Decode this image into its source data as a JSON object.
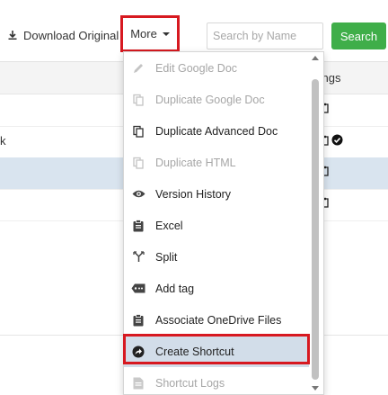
{
  "toolbar": {
    "download_label": "Download Original",
    "more_label": "More",
    "search_placeholder": "Search by Name",
    "search_button_label": "Search"
  },
  "table": {
    "column_header": "tings",
    "row_partial_text": "k"
  },
  "menu": {
    "items": [
      {
        "label": "Edit Google Doc",
        "icon": "pencil-icon",
        "disabled": true
      },
      {
        "label": "Duplicate Google Doc",
        "icon": "copy-icon",
        "disabled": true
      },
      {
        "label": "Duplicate Advanced Doc",
        "icon": "copy-icon",
        "disabled": false
      },
      {
        "label": "Duplicate HTML",
        "icon": "copy-icon",
        "disabled": true
      },
      {
        "label": "Version History",
        "icon": "eye-icon",
        "disabled": false
      },
      {
        "label": "Excel",
        "icon": "clipboard-icon",
        "disabled": false
      },
      {
        "label": "Split",
        "icon": "split-icon",
        "disabled": false
      },
      {
        "label": "Add tag",
        "icon": "tag-icon",
        "disabled": false
      },
      {
        "label": "Associate OneDrive Files",
        "icon": "clipboard-icon",
        "disabled": false
      },
      {
        "label": "Create Shortcut",
        "icon": "share-arrow-icon",
        "disabled": false,
        "highlighted": true
      },
      {
        "label": "Shortcut Logs",
        "icon": "document-icon",
        "disabled": true
      }
    ]
  },
  "colors": {
    "highlight_border": "#d71920",
    "search_button": "#3fae49",
    "selected_row": "#d9e4ef",
    "menu_highlight": "#d2dde9"
  }
}
